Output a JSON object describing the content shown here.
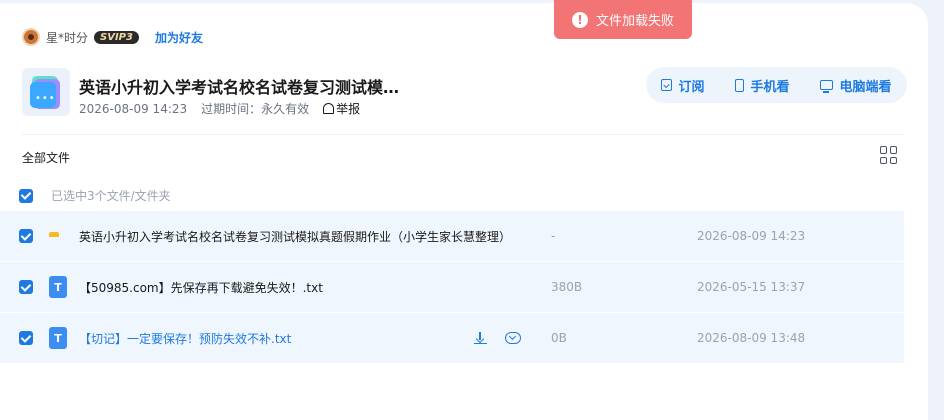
{
  "toast": {
    "icon": "alert-circle-icon",
    "message": "文件加载失败"
  },
  "user": {
    "name": "星*时分",
    "badge": "SVIP3",
    "add_friend": "加为好友"
  },
  "share": {
    "title": "英语小升初入学考试名校名试卷复习测试模…",
    "date": "2026-08-09 14:23",
    "expiry": "过期时间：永久有效",
    "report": "举报"
  },
  "actions": {
    "subscribe": "订阅",
    "mobile": "手机看",
    "pc": "电脑端看"
  },
  "files_header": {
    "label": "全部文件",
    "selected": "已选中3个文件/文件夹"
  },
  "files": [
    {
      "type": "folder",
      "name": "英语小升初入学考试名校名试卷复习测试模拟真题假期作业（小学生家长慧整理）",
      "size": "-",
      "date": "2026-08-09 14:23"
    },
    {
      "type": "txt",
      "name": "【50985.com】先保存再下载避免失效！.txt",
      "size": "380B",
      "date": "2026-05-15 13:37"
    },
    {
      "type": "txt",
      "name": "【切记】一定要保存！预防失效不补.txt",
      "size": "0B",
      "date": "2026-08-09 13:48"
    }
  ],
  "colors": {
    "accent": "#1f7ae0",
    "toast": "#f27474",
    "row_bg": "#f0f6fd"
  }
}
